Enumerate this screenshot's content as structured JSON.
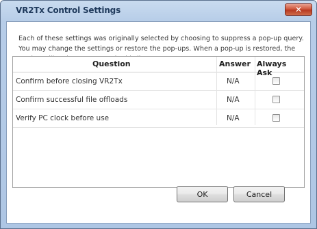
{
  "window": {
    "title": "VR2Tx Control Settings",
    "close_icon": "close-icon",
    "close_glyph": "✕"
  },
  "description": "Each of these settings was originally selected by choosing to suppress a pop-up query. You may change the settings or restore the pop-ups. When a pop-up is restored, the setting will no longer appear in this list.",
  "grid": {
    "columns": [
      "Question",
      "Answer",
      "Always Ask"
    ],
    "rows": [
      {
        "question": "Confirm before closing VR2Tx",
        "answer": "N/A",
        "always_ask": false
      },
      {
        "question": "Confirm successful file offloads",
        "answer": "N/A",
        "always_ask": false
      },
      {
        "question": "Verify PC clock before use",
        "answer": "N/A",
        "always_ask": false
      }
    ]
  },
  "buttons": {
    "ok": "OK",
    "cancel": "Cancel"
  }
}
